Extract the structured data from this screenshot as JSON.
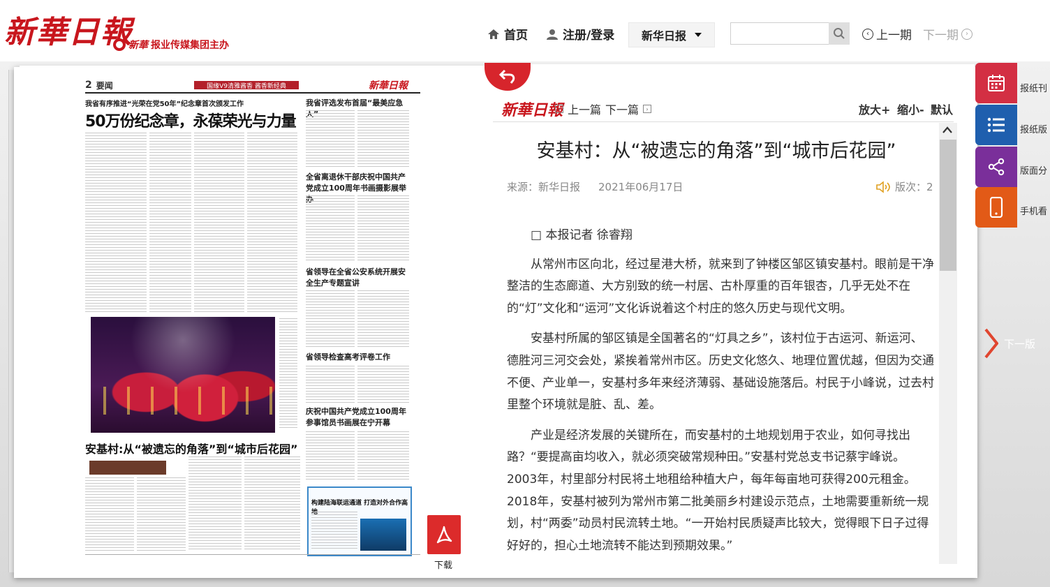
{
  "header": {
    "logo": "新華日報",
    "logo_sub_brand": "新華",
    "logo_sub_text": "报业传媒集团主办",
    "nav_home": "首页",
    "nav_login": "注册/登录",
    "paper_selector": "新华日报",
    "search_placeholder": "",
    "prev_issue": "上一期",
    "next_issue": "下一期"
  },
  "newspaper": {
    "page_number": "2",
    "section": "要闻",
    "ad_banner": "国缘V9清雅酱香 酱香新经典",
    "brand": "新華日報",
    "kicker": "我省有序推进“光荣在党50年”纪念章首次颁发工作",
    "headline": "50万份纪念章，永葆荣光与力量",
    "side_headlines": [
      "我省评选发布首届“最美应急人”",
      "全省离退休干部庆祝中国共产党成立100周年书画摄影展举办",
      "省领导在全省公安系统开展安全生产专题宣讲",
      "省领导检查高考评卷工作",
      "庆祝中国共产党成立100周年参事馆员书画展在宁开幕"
    ],
    "main_article_title": "安基村:从“被遗忘的角落”到“城市后花园”",
    "box_title": "构建陆海联运通道 打造对外合作高地",
    "download_label": "下载"
  },
  "reader": {
    "logo": "新華日報",
    "prev_article": "上一篇",
    "next_article": "下一篇",
    "zoom_in": "放大+",
    "zoom_out": "缩小-",
    "zoom_default": "默认",
    "title": "安基村：从“被遗忘的角落”到“城市后花园”",
    "source": "来源：新华日报",
    "date": "2021年06月17日",
    "edition": "版次：2",
    "byline": "□ 本报记者 徐睿翔",
    "paragraphs": [
      "从常州市区向北，经过星港大桥，就来到了钟楼区邹区镇安基村。眼前是干净整洁的生态廊道、大方别致的统一村居、古朴厚重的百年银杏，几乎无处不在的“灯”文化和“运河”文化诉说着这个村庄的悠久历史与现代文明。",
      "安基村所属的邹区镇是全国著名的“灯具之乡”，该村位于古运河、新运河、德胜河三河交会处，紧挨着常州市区。历史文化悠久、地理位置优越，但因为交通不便、产业单一，安基村多年来经济薄弱、基础设施落后。村民于小峰说，过去村里整个环境就是脏、乱、差。",
      "产业是经济发展的关键所在，而安基村的土地规划用于农业，如何寻找出路？“要提高亩均收入，就必须突破常规种田。”安基村党总支书记蔡宇峰说。2003年，村里部分村民将土地租给种植大户，每年每亩地可获得200元租金。2018年，安基村被列为常州市第二批美丽乡村建设示范点，土地需要重新统一规划，村“两委”动员村民流转土地。“一开始村民质疑声比较大，觉得眼下日子过得好好的，担心土地流转不能达到预期效果。”"
    ]
  },
  "tools": {
    "calendar": "报纸刊",
    "list": "报纸版",
    "share": "版面分",
    "phone": "手机看",
    "next_page": "下一版"
  },
  "colors": {
    "brand_red": "#c8161d",
    "tool_calendar": "#d32f43",
    "tool_list": "#1f5fae",
    "tool_share": "#7a2f9a",
    "tool_phone": "#e25a17"
  }
}
